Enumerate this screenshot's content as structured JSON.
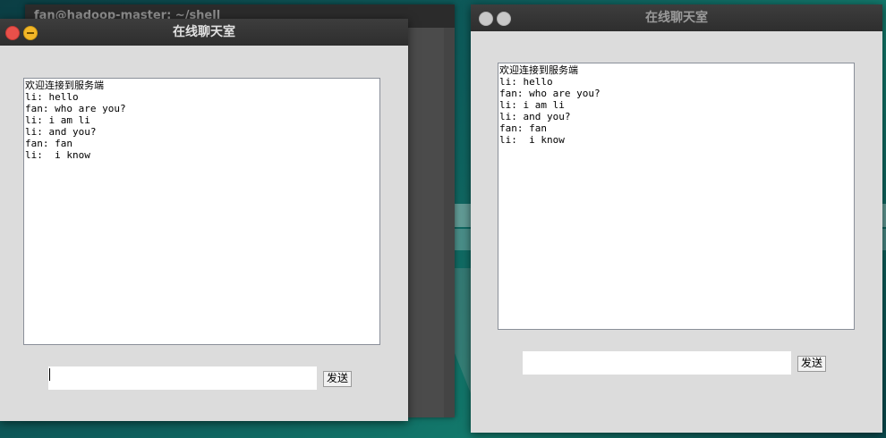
{
  "background_terminal": {
    "title": "fan@hadoop-master: ~/shell"
  },
  "window_left": {
    "title": "在线聊天室",
    "messages": [
      "欢迎连接到服务端",
      "li: hello",
      "fan: who are you?",
      "li: i am li",
      "li: and you?",
      "fan: fan",
      "li:  i know"
    ],
    "input_value": "",
    "send_label": "发送"
  },
  "window_right": {
    "title": "在线聊天室",
    "messages": [
      "欢迎连接到服务端",
      "li: hello",
      "fan: who are you?",
      "li: i am li",
      "li: and you?",
      "fan: fan",
      "li:  i know"
    ],
    "input_value": "",
    "send_label": "发送"
  }
}
